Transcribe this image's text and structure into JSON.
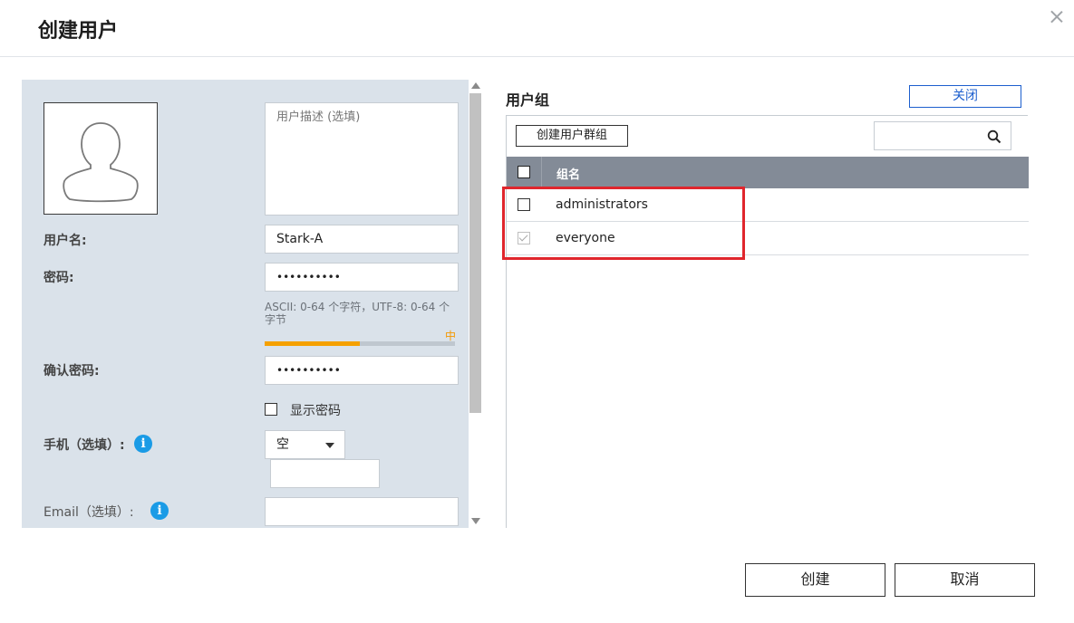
{
  "dialog": {
    "title": "创建用户"
  },
  "form": {
    "description_placeholder": "用户描述 (选填)",
    "username_label": "用户名:",
    "username_value": "Stark-A",
    "password_label": "密码:",
    "password_value": "••••••••••",
    "password_hint": "ASCII: 0-64 个字符，UTF-8: 0-64 个字节",
    "strength_label": "中",
    "strength_fraction": 0.5,
    "confirm_label": "确认密码:",
    "confirm_value": "••••••••••",
    "show_password_label": "显示密码",
    "show_password_checked": false,
    "phone_label": "手机（选填）:",
    "phone_country_value": "空",
    "phone_number_value": "",
    "email_label": "Email（选填）:",
    "email_value": "",
    "info_glyph": "i"
  },
  "groups": {
    "title": "用户组",
    "close_label": "关闭",
    "create_group_label": "创建用户群组",
    "search_value": "",
    "column_header": "组名",
    "rows": [
      {
        "name": "administrators",
        "checked": false,
        "disabled": false
      },
      {
        "name": "everyone",
        "checked": true,
        "disabled": true
      }
    ]
  },
  "footer": {
    "create_label": "创建",
    "cancel_label": "取消"
  },
  "colors": {
    "form_background": "#dae2ea",
    "accent_blue": "#1d5fce",
    "info_blue": "#1a9be6",
    "strength_orange": "#f5a000",
    "table_header": "#838b97",
    "highlight_red": "#e0262d"
  },
  "icons": {
    "close": "close-icon",
    "avatar": "user-silhouette-icon",
    "info": "info-icon",
    "dropdown": "chevron-down-icon",
    "search": "search-icon",
    "scroll_up": "scroll-up-arrow-icon",
    "scroll_down": "scroll-down-arrow-icon"
  }
}
